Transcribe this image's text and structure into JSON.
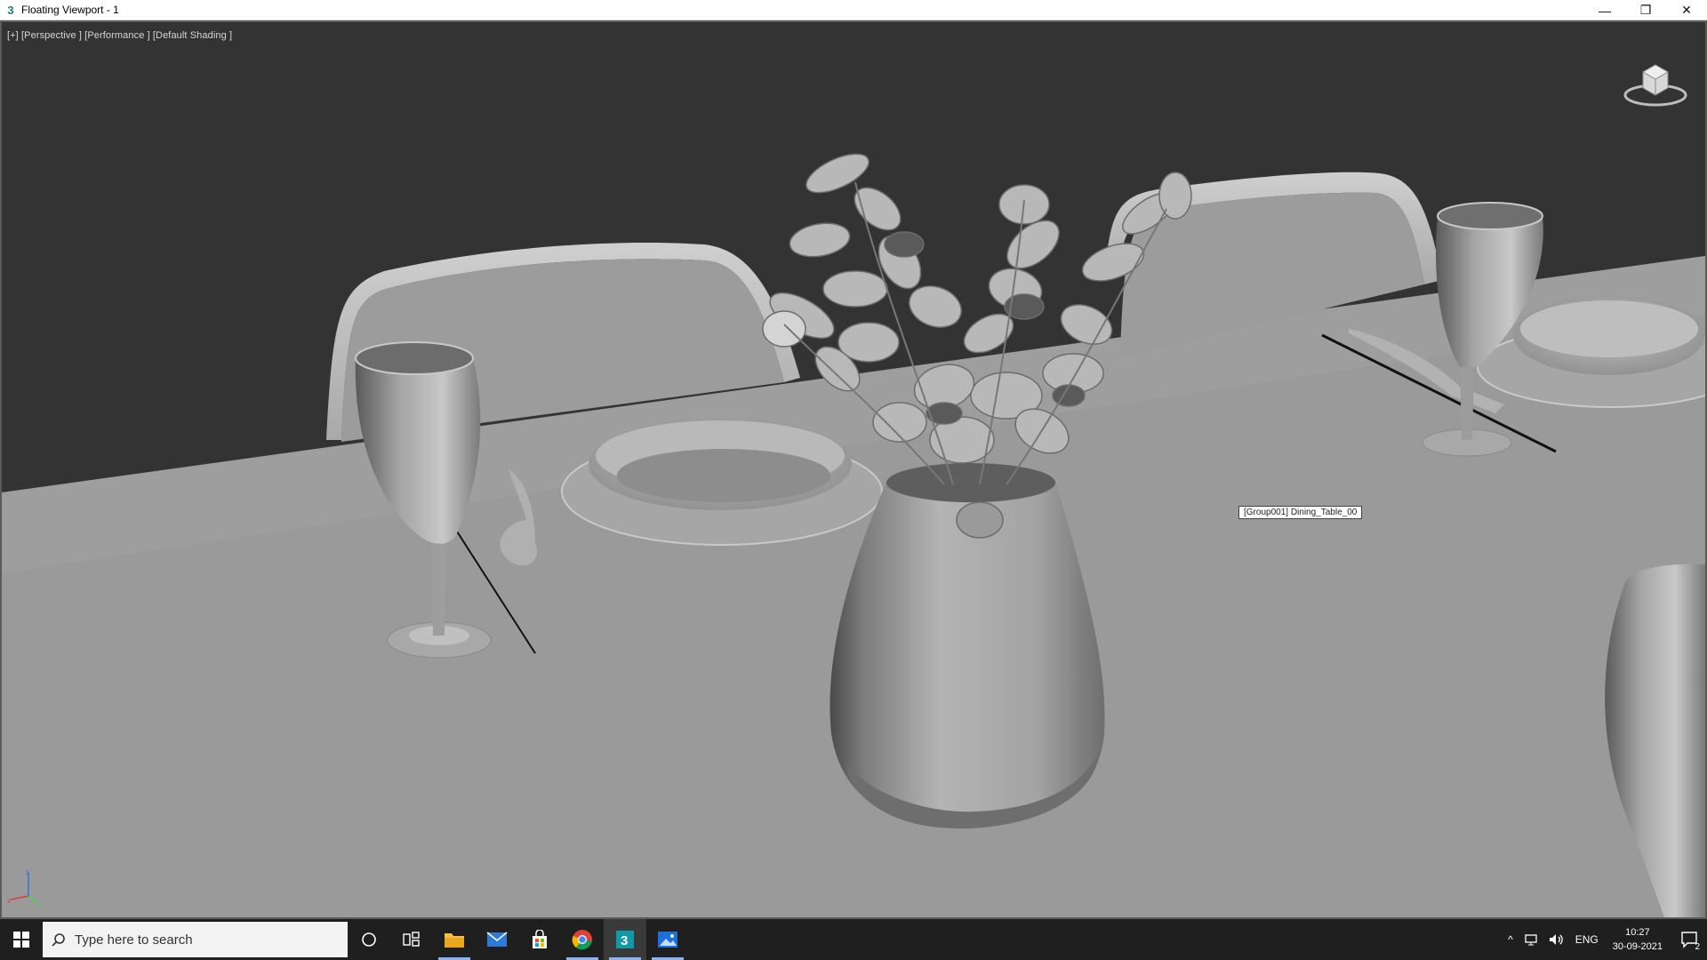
{
  "window": {
    "title": "Floating Viewport - 1",
    "minimize_glyph": "—",
    "restore_glyph": "❐",
    "close_glyph": "✕"
  },
  "viewport": {
    "label": "[+] [Perspective ] [Performance ] [Default Shading ]",
    "tooltip": "[Group001] Dining_Table_00",
    "background_color": "#333333",
    "table_color": "#9a9a9a"
  },
  "taskbar": {
    "search_placeholder": "Type here to search",
    "icons": [
      "cortana-icon",
      "task-view-icon",
      "file-explorer-icon",
      "mail-icon",
      "store-icon",
      "chrome-icon",
      "3dsmax-icon",
      "photos-icon"
    ],
    "tray": {
      "chevron": "^",
      "language": "ENG",
      "time": "10:27",
      "date": "30-09-2021",
      "notification_count": "2"
    }
  }
}
